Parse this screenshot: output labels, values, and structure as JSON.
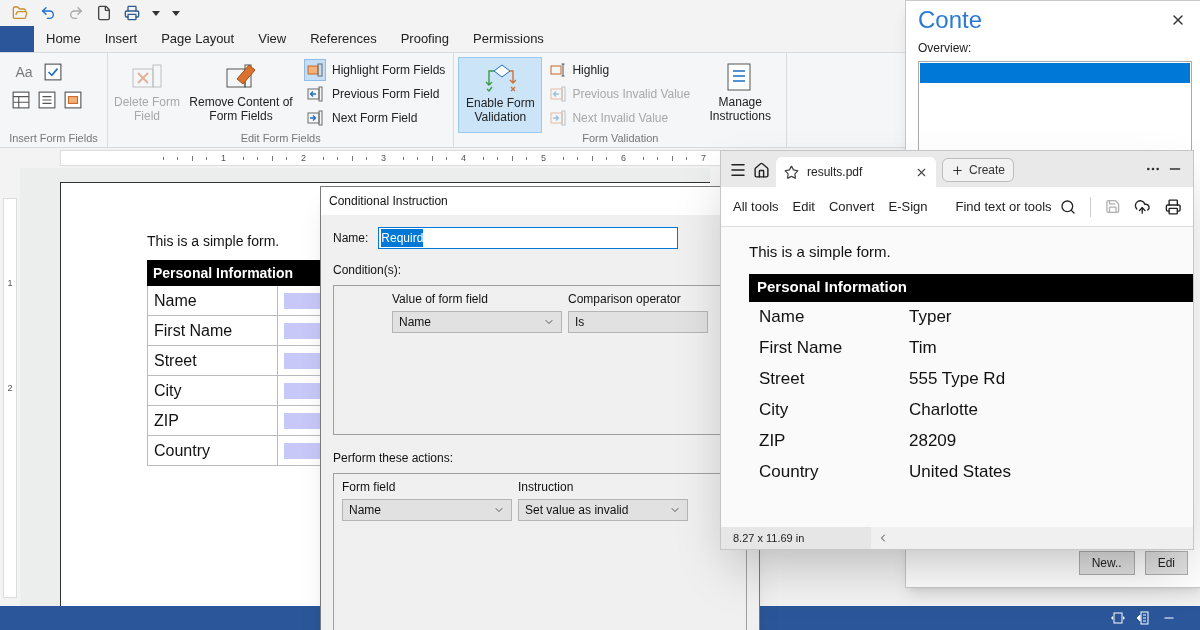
{
  "word": {
    "tabs": [
      {
        "label": "Home",
        "selected": false
      },
      {
        "label": "Insert",
        "selected": false
      },
      {
        "label": "Page Layout",
        "selected": false
      },
      {
        "label": "View",
        "selected": false
      },
      {
        "label": "References",
        "selected": false
      },
      {
        "label": "Proofing",
        "selected": false
      },
      {
        "label": "Permissions",
        "selected": false
      }
    ],
    "ribbon": {
      "insert_form_fields": {
        "label": "Insert Form Fields",
        "text_field_glyph": "Aa"
      },
      "edit_form_fields": {
        "label": "Edit Form Fields",
        "large_buttons": [
          {
            "label": "Delete Form Field",
            "disabled": true
          },
          {
            "label": "Remove Content of Form Fields",
            "disabled": false
          }
        ],
        "small_buttons": [
          {
            "label": "Highlight Form Fields",
            "on": true
          },
          {
            "label": "Previous Form Field",
            "on": false
          },
          {
            "label": "Next Form Field",
            "on": false
          }
        ]
      },
      "form_validation": {
        "label": "Form Validation",
        "enable_button": {
          "label": "Enable Form Validation",
          "on": true
        },
        "small_buttons": [
          {
            "label": "Highlig",
            "disabled": false
          },
          {
            "label": "Previous Invalid Value",
            "disabled": true
          },
          {
            "label": "Next Invalid Value",
            "disabled": true
          }
        ],
        "manage_button": {
          "label": "Manage Instructions"
        }
      }
    },
    "ruler": {
      "marks": [
        "1",
        "2",
        "3",
        "4",
        "5",
        "6",
        "7"
      ]
    },
    "vertical_ruler": {
      "marks": [
        "1",
        "2"
      ]
    },
    "document": {
      "intro": "This is a simple form.",
      "table": {
        "header": "Personal Information",
        "rows": [
          "Name",
          "First Name",
          "Street",
          "City",
          "ZIP",
          "Country"
        ]
      }
    }
  },
  "instructions_window": {
    "title": "Conte",
    "overview_label": "Overview:",
    "items": [
      {
        "selected": true
      }
    ],
    "buttons": [
      "New..",
      "Edi"
    ]
  },
  "dialog": {
    "title": "Conditional Instruction",
    "name_label": "Name:",
    "name_value": "Requird",
    "name_text_selected": true,
    "conditions": {
      "label": "Condition(s):",
      "columns": [
        "Value of form field",
        "Comparison operator"
      ],
      "rows": [
        {
          "field": "Name",
          "operator": "Is"
        }
      ]
    },
    "actions": {
      "label": "Perform these actions:",
      "columns": [
        "Form field",
        "Instruction"
      ],
      "rows": [
        {
          "field": "Name",
          "instruction": "Set value as invalid"
        }
      ]
    }
  },
  "pdf": {
    "tab": {
      "title": "results.pdf"
    },
    "create_label": "Create",
    "menu": [
      "All tools",
      "Edit",
      "Convert",
      "E-Sign"
    ],
    "search_label": "Find text or tools",
    "save_disabled": true,
    "document": {
      "intro": "This is a simple form.",
      "header": "Personal Information",
      "rows": [
        {
          "label": "Name",
          "value": "Typer"
        },
        {
          "label": "First Name",
          "value": "Tim"
        },
        {
          "label": "Street",
          "value": "555 Type Rd"
        },
        {
          "label": "City",
          "value": "Charlotte"
        },
        {
          "label": "ZIP",
          "value": "28209"
        },
        {
          "label": "Country",
          "value": "United States"
        }
      ]
    },
    "page_size": "8.27 x 11.69 in"
  }
}
